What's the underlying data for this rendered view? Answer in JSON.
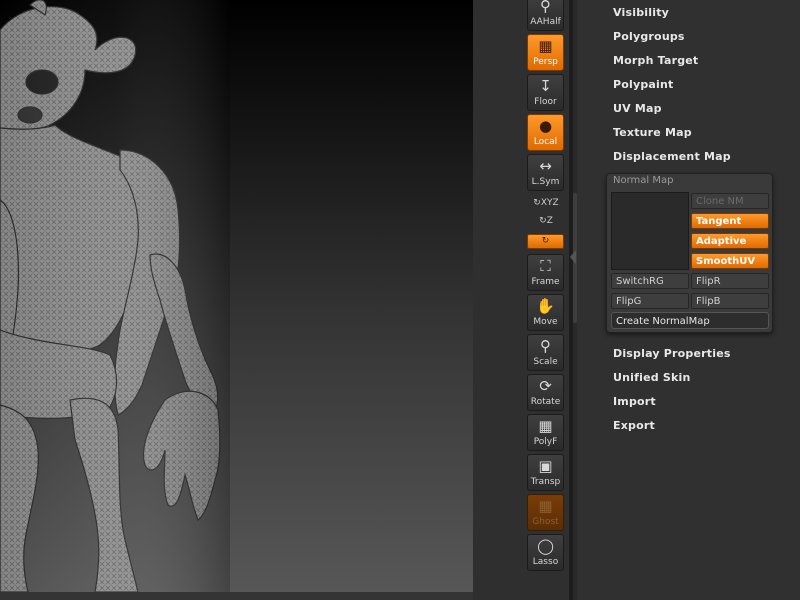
{
  "shelf": {
    "aahalf": "AAHalf",
    "persp": "Persp",
    "floor": "Floor",
    "local": "Local",
    "lsym": "L.Sym",
    "xyz": "XYZ",
    "z": "Z",
    "frame": "Frame",
    "move": "Move",
    "scale": "Scale",
    "rotate": "Rotate",
    "polyf": "PolyF",
    "transp": "Transp",
    "ghost": "Ghost",
    "lasso": "Lasso"
  },
  "palette": {
    "items_top": [
      "Visibility",
      "Polygroups",
      "Morph Target",
      "Polypaint",
      "UV Map",
      "Texture Map",
      "Displacement Map"
    ],
    "normal_map": {
      "title": "Normal Map",
      "clone_nm": "Clone NM",
      "tangent": "Tangent",
      "adaptive": "Adaptive",
      "smoothuv": "SmoothUV",
      "switchrg": "SwitchRG",
      "flipr": "FlipR",
      "flipg": "FlipG",
      "flipb": "FlipB",
      "create": "Create NormalMap"
    },
    "items_bottom": [
      "Display Properties",
      "Unified Skin",
      "Import",
      "Export"
    ]
  },
  "colors": {
    "accent": "#f07e10",
    "background": "#303030",
    "viewport_top": "#000000",
    "viewport_bottom": "#575757"
  }
}
